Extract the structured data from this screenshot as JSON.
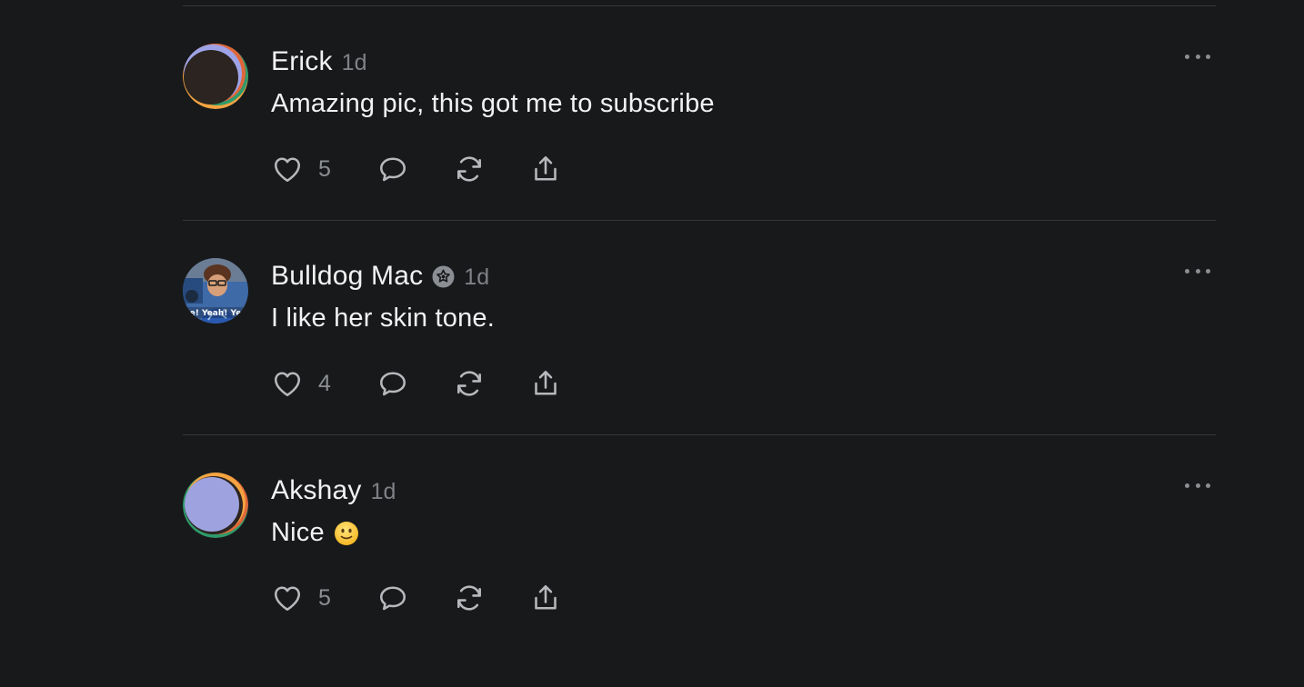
{
  "comments": [
    {
      "author": "Erick",
      "verified": false,
      "time": "1d",
      "text": "Amazing pic, this got me to subscribe",
      "emoji": "",
      "likes": "5",
      "avatar": "gradient-avatar-dark"
    },
    {
      "author": "Bulldog Mac",
      "verified": true,
      "time": "1d",
      "text": "I like her skin tone.",
      "emoji": "",
      "likes": "4",
      "avatar": "photo-avatar",
      "avatar_caption": "e! Yeah! Ye"
    },
    {
      "author": "Akshay",
      "verified": false,
      "time": "1d",
      "text": "Nice",
      "emoji": "slightly-smiling-face",
      "likes": "5",
      "avatar": "gradient-avatar-lavender"
    }
  ],
  "icons": {
    "like": "heart-icon",
    "reply": "speech-bubble-icon",
    "repost": "repost-icon",
    "share": "share-icon",
    "more": "more-horizontal-icon",
    "verified": "verified-badge-icon"
  },
  "colors": {
    "background": "#18191b",
    "divider": "#35373a",
    "text": "#f2f2f2",
    "muted": "#8b8e92"
  }
}
